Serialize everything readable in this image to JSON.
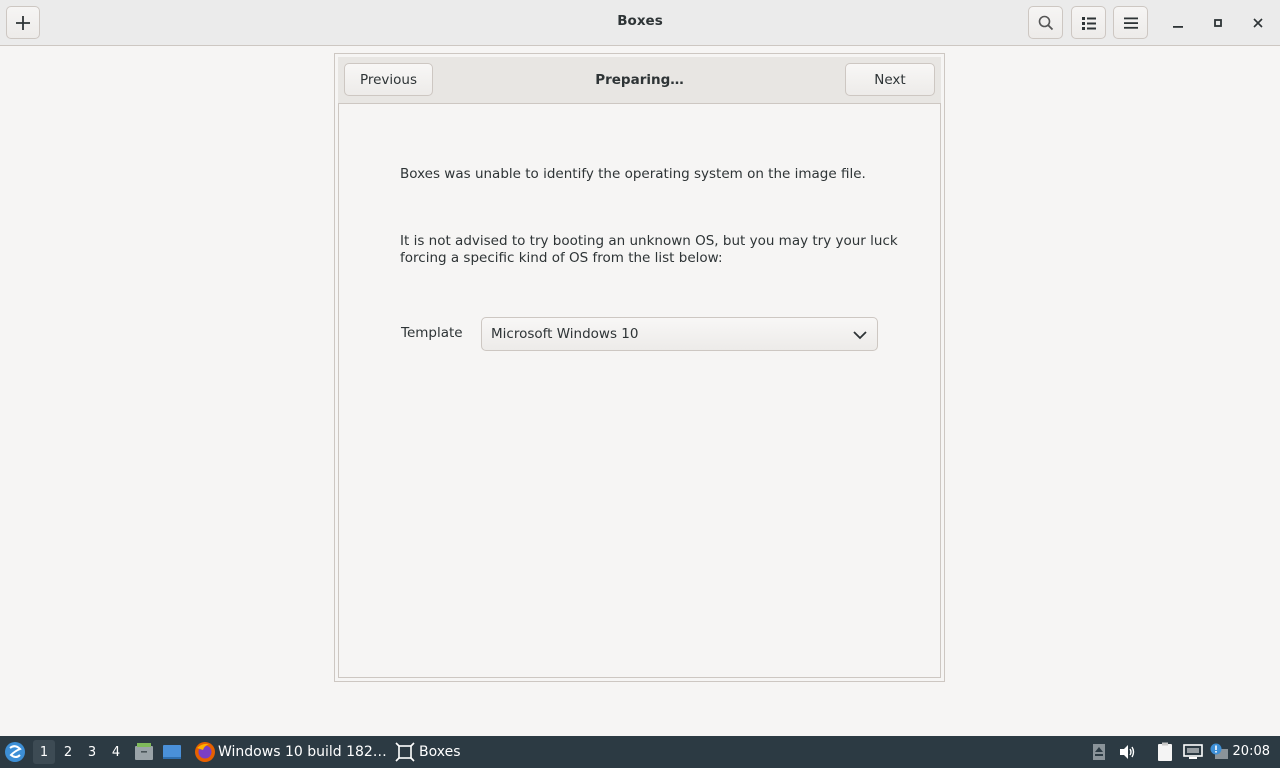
{
  "window": {
    "title": "Boxes",
    "new_button_icon": "plus-icon",
    "search_icon": "search-icon",
    "view_icon": "list-view-icon",
    "menu_icon": "hamburger-menu-icon"
  },
  "dialog": {
    "title": "Preparing…",
    "previous_label": "Previous",
    "next_label": "Next",
    "message_1": "Boxes was unable to identify the operating system on the image file.",
    "message_2_line1": "It is not advised to try booting an unknown OS, but you may try your luck",
    "message_2_line2": "forcing a specific kind of OS from the list below:",
    "template_label": "Template",
    "template_selected": "Microsoft Windows 10"
  },
  "taskbar": {
    "workspaces": [
      "1",
      "2",
      "3",
      "4"
    ],
    "active_workspace": "1",
    "tasks": [
      {
        "label": "Windows 10 build 182…",
        "icon": "firefox-icon"
      },
      {
        "label": "Boxes",
        "icon": "boxes-icon"
      }
    ],
    "clock": "20:08"
  },
  "colors": {
    "taskbar_bg": "#2c3a43",
    "window_bg": "#f6f5f4",
    "headerbar_bg": "#ebebeb"
  }
}
